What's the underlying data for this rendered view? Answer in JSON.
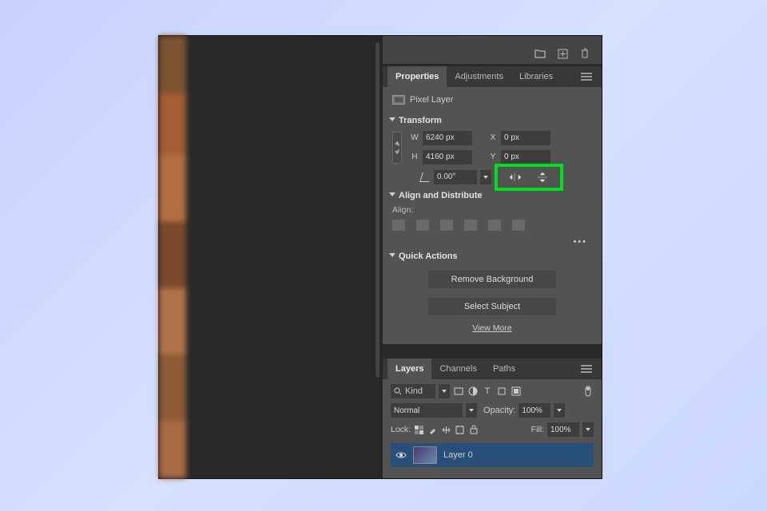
{
  "top_icons": {
    "folder": "folder-icon",
    "new": "new-layer-icon",
    "trash": "trash-icon"
  },
  "properties_panel": {
    "tabs": {
      "properties": "Properties",
      "adjustments": "Adjustments",
      "libraries": "Libraries"
    },
    "layer_type": "Pixel Layer",
    "transform": {
      "title": "Transform",
      "w_label": "W",
      "w_value": "6240 px",
      "h_label": "H",
      "h_value": "4160 px",
      "x_label": "X",
      "x_value": "0 px",
      "y_label": "Y",
      "y_value": "0 px",
      "angle": "0.00°"
    },
    "align": {
      "title": "Align and Distribute",
      "label": "Align:"
    },
    "quick_actions": {
      "title": "Quick Actions",
      "remove_bg": "Remove Background",
      "select_subject": "Select Subject",
      "view_more": "View More"
    }
  },
  "layers_panel": {
    "tabs": {
      "layers": "Layers",
      "channels": "Channels",
      "paths": "Paths"
    },
    "kind_label": "Kind",
    "blend_mode": "Normal",
    "opacity_label": "Opacity:",
    "opacity_value": "100%",
    "lock_label": "Lock:",
    "fill_label": "Fill:",
    "fill_value": "100%",
    "layer0": "Layer 0"
  },
  "highlight": "flip-controls"
}
